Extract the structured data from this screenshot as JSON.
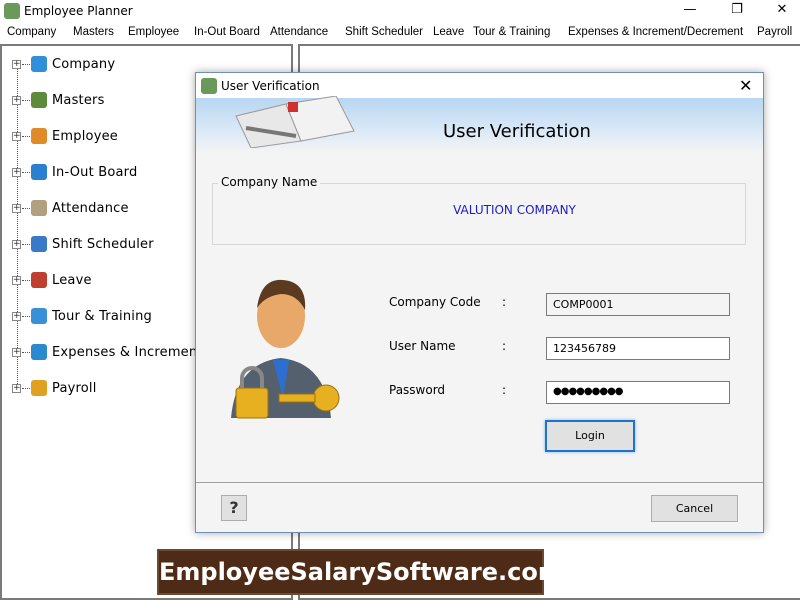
{
  "app": {
    "title": "Employee Planner",
    "minimize": "—",
    "maximize": "❐",
    "close": "✕"
  },
  "menu": [
    "Company",
    "Masters",
    "Employee",
    "In-Out Board",
    "Attendance",
    "Shift Scheduler",
    "Leave",
    "Tour & Training",
    "Expenses & Increment/Decrement",
    "Payroll"
  ],
  "tree": [
    {
      "label": "Company",
      "icon": "building-icon",
      "color": "#2f8fd8"
    },
    {
      "label": "Masters",
      "icon": "layers-icon",
      "color": "#5f8a3a"
    },
    {
      "label": "Employee",
      "icon": "people-icon",
      "color": "#e08a2a"
    },
    {
      "label": "In-Out Board",
      "icon": "arrows-icon",
      "color": "#2a7fd0"
    },
    {
      "label": "Attendance",
      "icon": "checklist-icon",
      "color": "#b0a080"
    },
    {
      "label": "Shift Scheduler",
      "icon": "clock-icon",
      "color": "#3a78c8"
    },
    {
      "label": "Leave",
      "icon": "calendar-icon",
      "color": "#c04030"
    },
    {
      "label": "Tour & Training",
      "icon": "airplane-icon",
      "color": "#3a90d8"
    },
    {
      "label": "Expenses & Increment",
      "icon": "wallet-icon",
      "color": "#2a8ad0"
    },
    {
      "label": "Payroll",
      "icon": "coin-icon",
      "color": "#e0a020"
    }
  ],
  "dialog": {
    "title": "User Verification",
    "banner_title": "User Verification",
    "group_label": "Company Name",
    "company_name": "VALUTION COMPANY",
    "fields": [
      {
        "label": "Company Code",
        "colon": ":",
        "value": "COMP0001"
      },
      {
        "label": "User Name",
        "colon": ":",
        "value": "123456789"
      },
      {
        "label": "Password",
        "colon": ":",
        "value": "●●●●●●●●●"
      }
    ],
    "login": "Login",
    "cancel": "Cancel",
    "help": "?"
  },
  "watermark": "EmployeeSalarySoftware.com"
}
